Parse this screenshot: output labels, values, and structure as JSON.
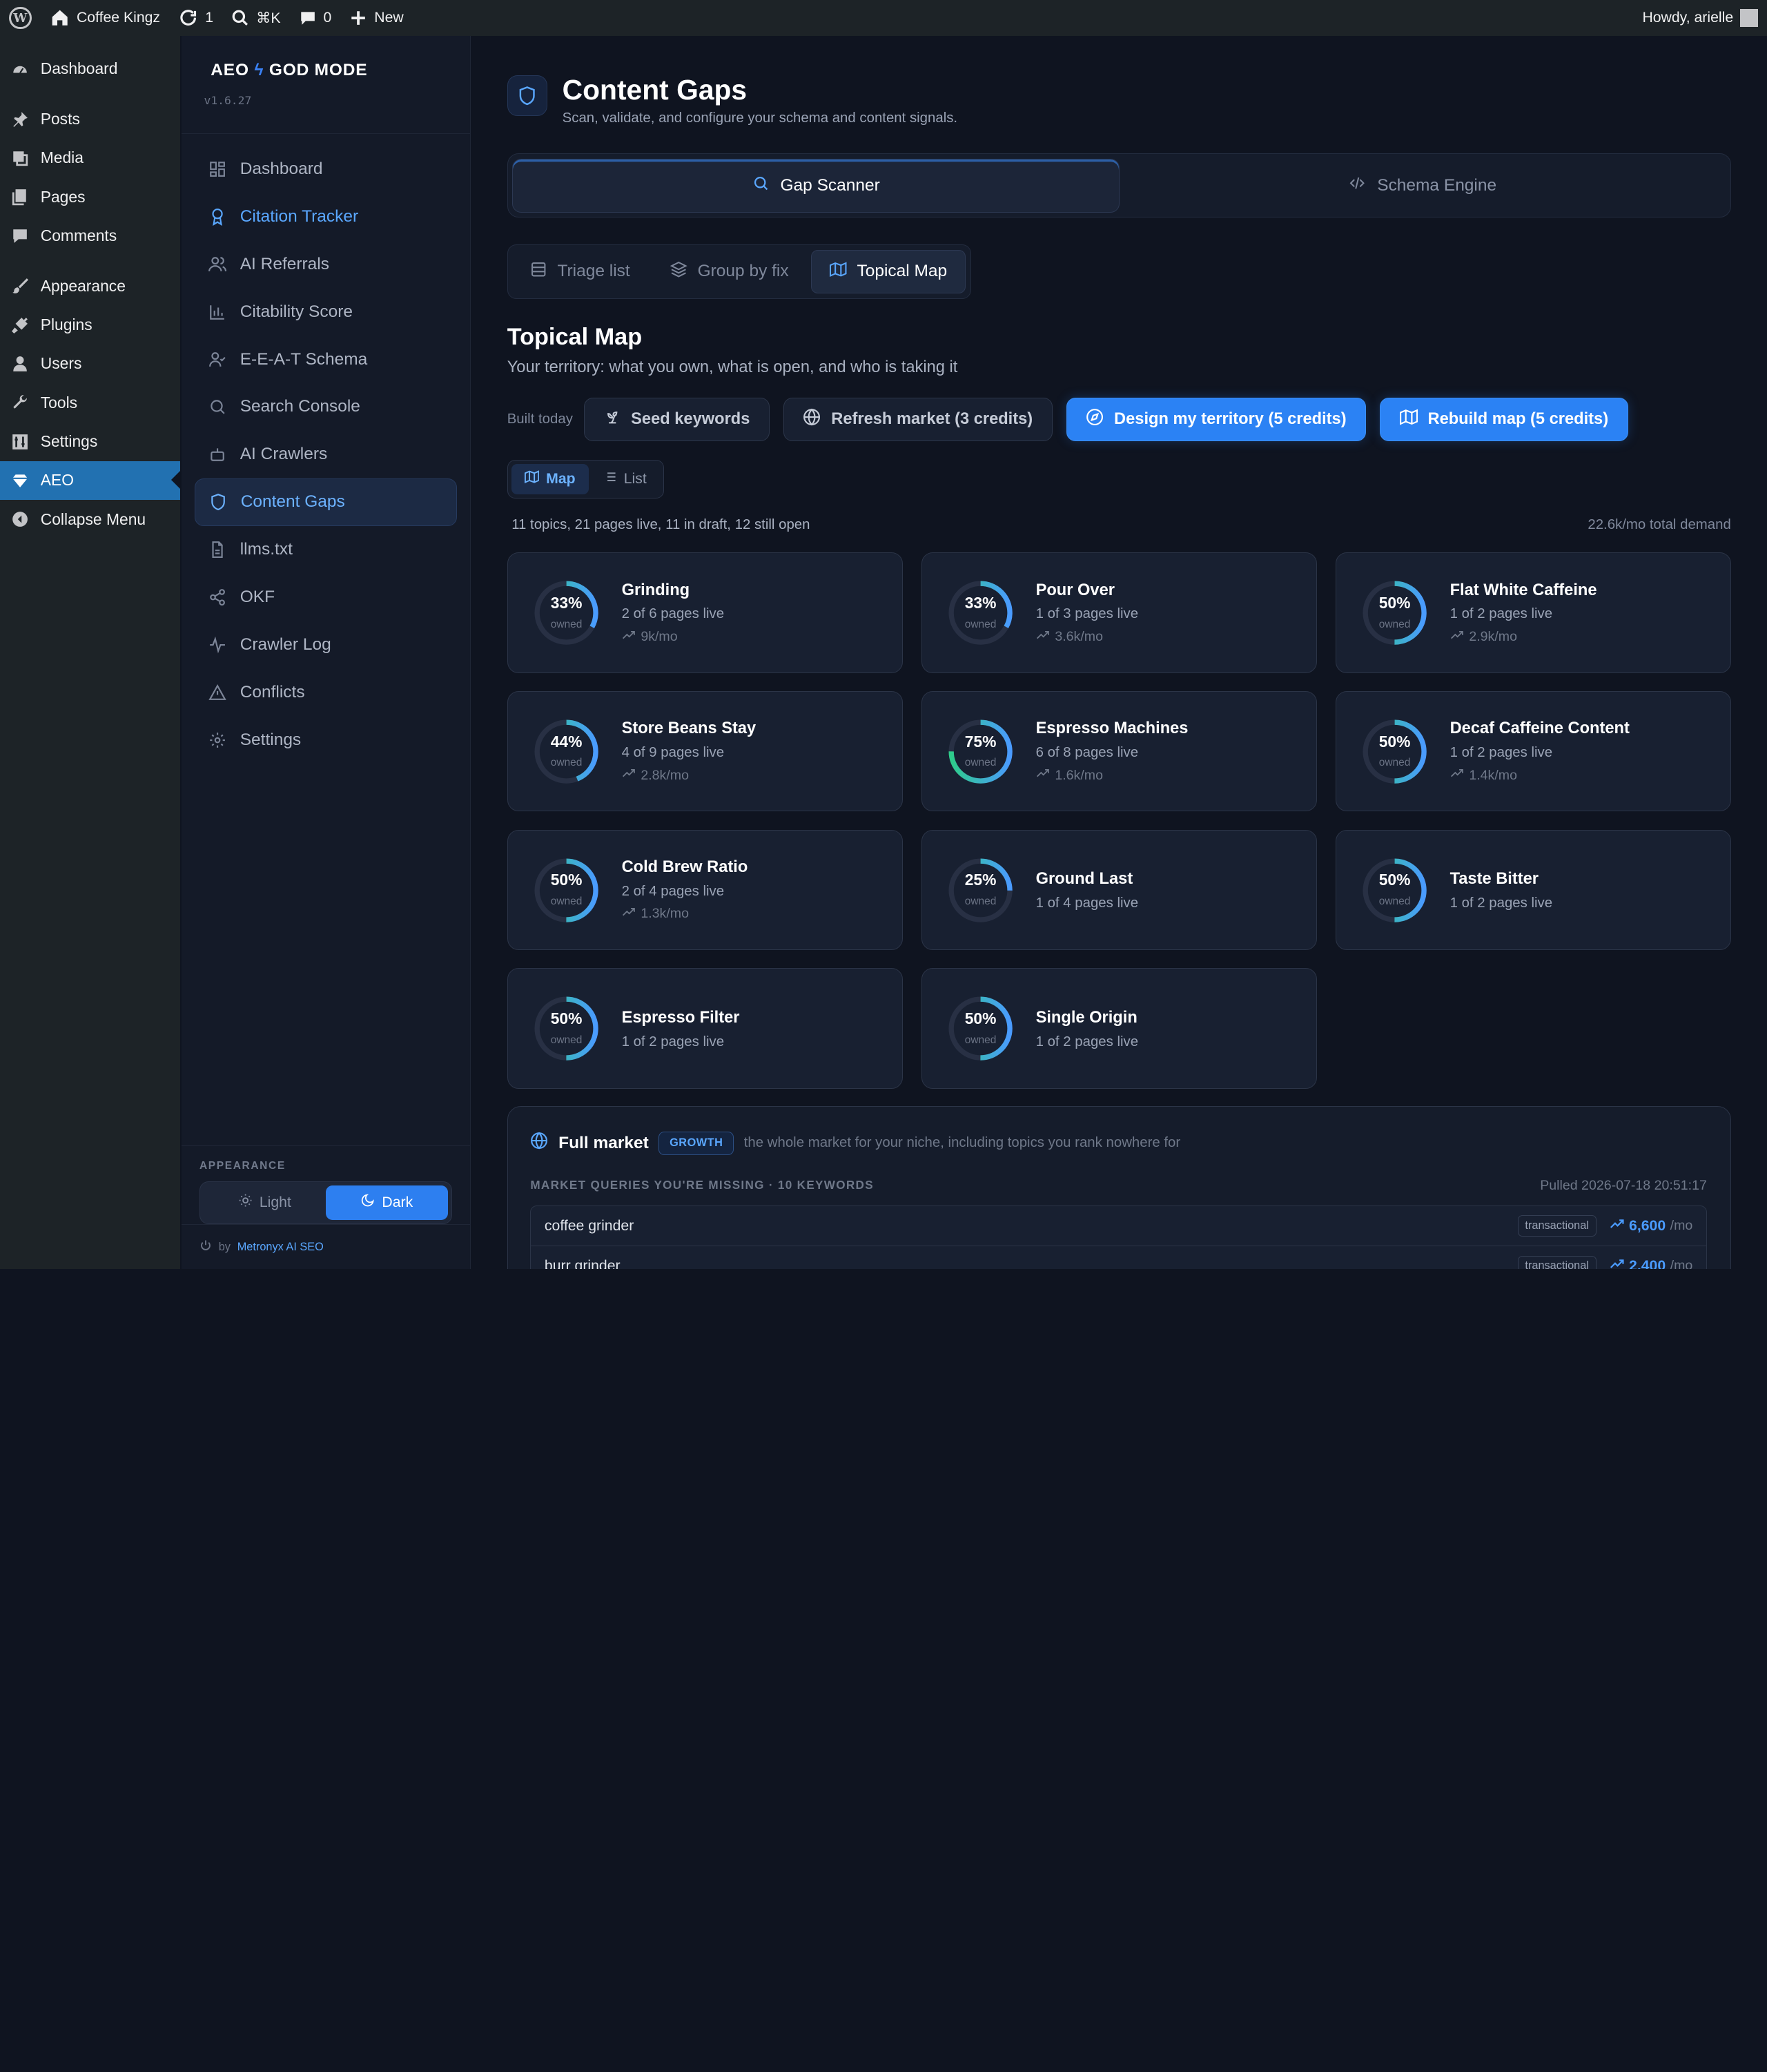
{
  "admin_bar": {
    "site_name": "Coffee Kingz",
    "updates_count": "1",
    "search_shortcut": "⌘K",
    "comments_count": "0",
    "new_label": "New",
    "howdy": "Howdy, arielle"
  },
  "wp_menu": [
    {
      "label": "Dashboard",
      "icon": "dashboard-icon"
    },
    {
      "label": "Posts",
      "icon": "pin-icon"
    },
    {
      "label": "Media",
      "icon": "media-icon"
    },
    {
      "label": "Pages",
      "icon": "pages-icon"
    },
    {
      "label": "Comments",
      "icon": "comment-icon"
    },
    {
      "label": "Appearance",
      "icon": "brush-icon"
    },
    {
      "label": "Plugins",
      "icon": "plug-icon"
    },
    {
      "label": "Users",
      "icon": "user-icon"
    },
    {
      "label": "Tools",
      "icon": "wrench-icon"
    },
    {
      "label": "Settings",
      "icon": "settings-icon"
    },
    {
      "label": "AEO",
      "icon": "diamond-icon",
      "active": true
    },
    {
      "label": "Collapse Menu",
      "icon": "collapse-icon"
    }
  ],
  "plugin_sidebar": {
    "brand_a": "AEO",
    "brand_b": "GOD MODE",
    "version": "v1.6.27",
    "items": [
      {
        "label": "Dashboard",
        "icon": "grid-icon"
      },
      {
        "label": "Citation Tracker",
        "icon": "award-icon"
      },
      {
        "label": "AI Referrals",
        "icon": "users-icon"
      },
      {
        "label": "Citability Score",
        "icon": "bar-chart-icon"
      },
      {
        "label": "E-E-A-T Schema",
        "icon": "user-check-icon"
      },
      {
        "label": "Search Console",
        "icon": "search-icon"
      },
      {
        "label": "AI Crawlers",
        "icon": "bot-icon"
      },
      {
        "label": "Content Gaps",
        "icon": "shield-icon",
        "active": true
      },
      {
        "label": "llms.txt",
        "icon": "file-icon"
      },
      {
        "label": "OKF",
        "icon": "share-icon"
      },
      {
        "label": "Crawler Log",
        "icon": "activity-icon"
      },
      {
        "label": "Conflicts",
        "icon": "alert-triangle-icon"
      },
      {
        "label": "Settings",
        "icon": "gear-icon"
      }
    ],
    "appearance_label": "APPEARANCE",
    "light_label": "Light",
    "dark_label": "Dark",
    "footer_by": "by",
    "footer_link": "Metronyx AI SEO"
  },
  "header": {
    "title": "Content Gaps",
    "subtitle": "Scan, validate, and configure your schema and content signals."
  },
  "main_tabs": [
    {
      "label": "Gap Scanner",
      "active": true
    },
    {
      "label": "Schema Engine",
      "active": false
    }
  ],
  "sub_tabs": [
    {
      "label": "Triage list"
    },
    {
      "label": "Group by fix"
    },
    {
      "label": "Topical Map",
      "active": true
    }
  ],
  "section": {
    "title": "Topical Map",
    "subtitle": "Your territory: what you own, what is open, and who is taking it"
  },
  "actions": {
    "built_label": "Built today",
    "seed": "Seed keywords",
    "refresh": "Refresh market (3 credits)",
    "design": "Design my territory (5 credits)",
    "rebuild": "Rebuild map (5 credits)"
  },
  "view_toggle": {
    "map": "Map",
    "list": "List"
  },
  "summary": {
    "left": "11 topics, 21 pages live, 11 in draft, 12 still open",
    "right": "22.6k/mo total demand"
  },
  "owned_label": "owned",
  "colors": {
    "accent": "#2b82f4",
    "ring_green": "#2ecc8a",
    "ring_blue": "#4a9bff"
  },
  "topics": [
    {
      "name": "Grinding",
      "pct": 33,
      "pages": "2 of 6 pages live",
      "demand": "9k/mo"
    },
    {
      "name": "Pour Over",
      "pct": 33,
      "pages": "1 of 3 pages live",
      "demand": "3.6k/mo"
    },
    {
      "name": "Flat White Caffeine",
      "pct": 50,
      "pages": "1 of 2 pages live",
      "demand": "2.9k/mo"
    },
    {
      "name": "Store Beans Stay",
      "pct": 44,
      "pages": "4 of 9 pages live",
      "demand": "2.8k/mo"
    },
    {
      "name": "Espresso Machines",
      "pct": 75,
      "pages": "6 of 8 pages live",
      "demand": "1.6k/mo"
    },
    {
      "name": "Decaf Caffeine Content",
      "pct": 50,
      "pages": "1 of 2 pages live",
      "demand": "1.4k/mo"
    },
    {
      "name": "Cold Brew Ratio",
      "pct": 50,
      "pages": "2 of 4 pages live",
      "demand": "1.3k/mo"
    },
    {
      "name": "Ground Last",
      "pct": 25,
      "pages": "1 of 4 pages live",
      "demand": ""
    },
    {
      "name": "Taste Bitter",
      "pct": 50,
      "pages": "1 of 2 pages live",
      "demand": ""
    },
    {
      "name": "Espresso Filter",
      "pct": 50,
      "pages": "1 of 2 pages live",
      "demand": ""
    },
    {
      "name": "Single Origin",
      "pct": 50,
      "pages": "1 of 2 pages live",
      "demand": ""
    }
  ],
  "market": {
    "title": "Full market",
    "badge": "GROWTH",
    "desc": "the whole market for your niche, including topics you rank nowhere for",
    "missing_label": "MARKET QUERIES YOU'RE MISSING · 10 KEYWORDS",
    "pulled": "Pulled 2026-07-18 20:51:17",
    "per_mo": "/mo",
    "rows": [
      {
        "keyword": "coffee grinder",
        "intent": "transactional",
        "volume": "6,600"
      },
      {
        "keyword": "burr grinder",
        "intent": "transactional",
        "volume": "2,400"
      }
    ]
  }
}
